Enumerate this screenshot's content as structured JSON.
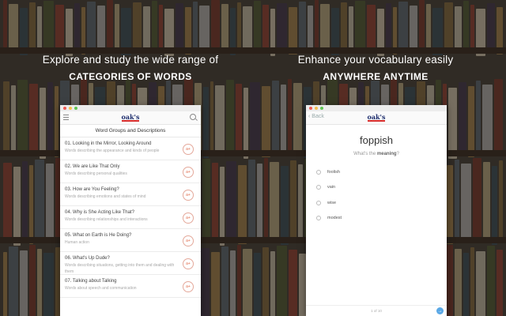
{
  "left_panel": {
    "headline_line1": "Explore and study the wide range of",
    "headline_line2": "CATEGORIES OF WORDS",
    "logo": "oak's",
    "section_title": "Word Groups and Descriptions",
    "items": [
      {
        "title": "01. Looking in the Mirror, Looking Around",
        "desc": "Words describing the appearance and kinds of people"
      },
      {
        "title": "02. We are Like That Only",
        "desc": "Words describing personal qualities"
      },
      {
        "title": "03. How are You Feeling?",
        "desc": "Words describing emotions and states of mind"
      },
      {
        "title": "04. Why is She Acting Like That?",
        "desc": "Words describing relationships and interactions"
      },
      {
        "title": "05. What on Earth is He Doing?",
        "desc": "Human action"
      },
      {
        "title": "06. What's Up Dude?",
        "desc": "Words describing situations, getting into them and dealing with them"
      },
      {
        "title": "07. Talking about Talking",
        "desc": "Words about speech and communication"
      }
    ],
    "item_icon": "a+"
  },
  "right_panel": {
    "headline_line1": "Enhance your vocabulary easily",
    "headline_line2": "ANYWHERE ANYTIME",
    "logo": "oak's",
    "back_label": "Back",
    "word": "foppish",
    "question_prefix": "What's the ",
    "question_keyword": "meaning",
    "question_suffix": "?",
    "options": [
      "foolish",
      "vain",
      "wise",
      "modest"
    ],
    "counter": "1 of 10",
    "next_icon": "→"
  },
  "colors": {
    "accent": "#e06a4a",
    "next_button": "#5aa8e6",
    "logo_blue": "#1e2e6e",
    "logo_red": "#d62b2b"
  },
  "icons": [
    "menu-icon",
    "search-icon",
    "back-chevron-icon",
    "add-icon",
    "arrow-right-icon"
  ]
}
